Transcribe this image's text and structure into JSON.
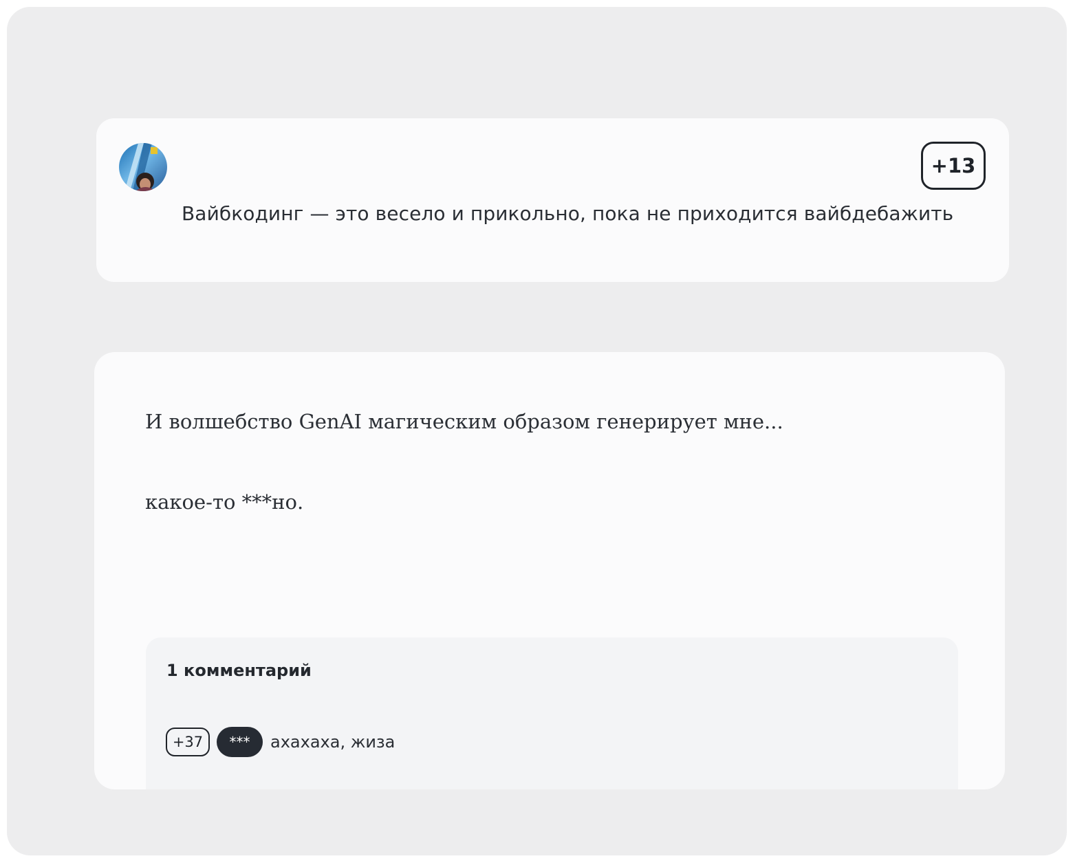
{
  "post": {
    "avatar_icon": "user-photo-avatar",
    "score": "+13",
    "title": "Вайбкодинг — это весело и прикольно, пока не приходится вайбдебажить"
  },
  "content": {
    "paragraphs": [
      "И волшебство GenAI магическим образом генерирует мне...",
      "какое-то ***но."
    ]
  },
  "comments": {
    "count_label": "1 комментарий",
    "items": [
      {
        "score": "+37",
        "author": "***",
        "text": "ахахаха, жиза"
      }
    ]
  },
  "colors": {
    "background": "#ededee",
    "card": "#fbfbfc",
    "comments_bg": "#f3f4f6",
    "text": "#2a2e34",
    "author_pill": "#262b33"
  }
}
